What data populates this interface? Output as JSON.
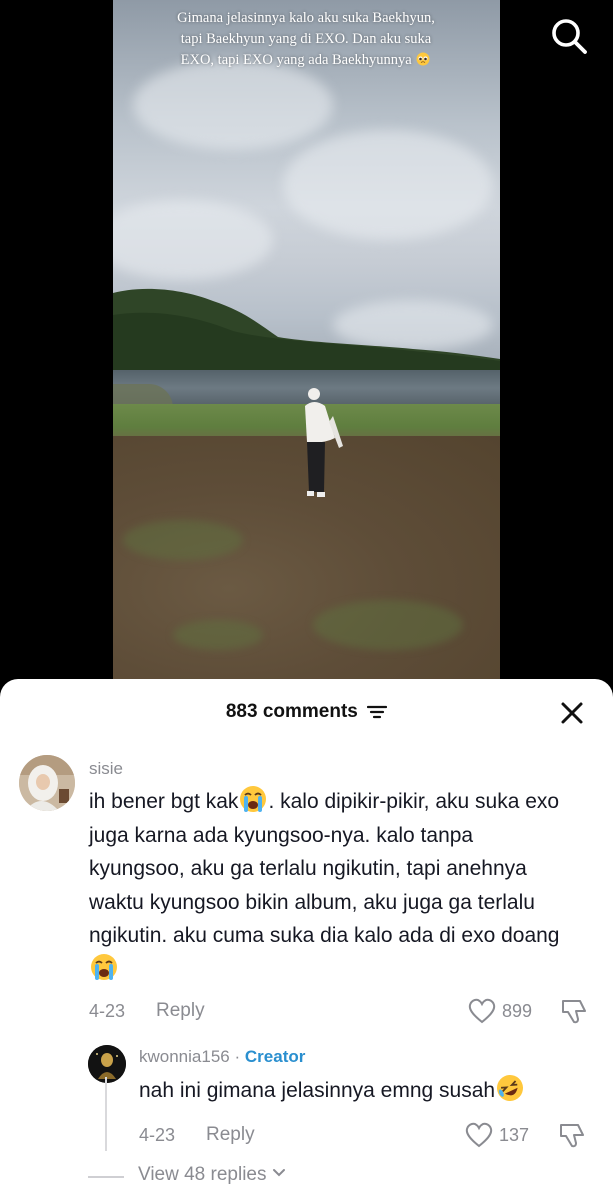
{
  "video": {
    "caption": "Gimana jelasinnya kalo aku suka Baekhyun, tapi Baekhyun yang di EXO. Dan aku suka EXO, tapi EXO yang ada Baekhyunnya",
    "caption_emoji": "pleading-face-emoji"
  },
  "top_bar": {
    "search_icon": "search-icon"
  },
  "comments_panel": {
    "count_label": "883 comments",
    "filter_icon": "filter-icon",
    "close_icon": "close-icon",
    "comments": [
      {
        "username": "sisie",
        "text_parts": [
          "ih bener bgt kak",
          ". kalo dipikir-pikir, aku suka exo juga karna ada kyungsoo-nya. kalo tanpa kyungsoo, aku ga terlalu ngikutin, tapi anehnya waktu kyungsoo bikin album, aku juga ga terlalu ngikutin. aku cuma suka dia kalo ada di exo doang"
        ],
        "emojis": [
          "loudly-crying-face-emoji",
          "loudly-crying-face-emoji"
        ],
        "date": "4-23",
        "reply_label": "Reply",
        "likes": "899"
      }
    ],
    "replies": [
      {
        "username": "kwonnia156",
        "separator": "·",
        "badge": "Creator",
        "text": "nah ini gimana jelasinnya emng susah",
        "emoji": "rolling-on-floor-laughing-emoji",
        "date": "4-23",
        "reply_label": "Reply",
        "likes": "137"
      }
    ],
    "view_replies_label": "View 48 replies"
  },
  "colors": {
    "sheet_bg": "#ffffff",
    "text_primary": "#161823",
    "text_secondary": "#8a8b91",
    "creator_badge": "#2a8fcf",
    "backdrop": "#000000"
  }
}
